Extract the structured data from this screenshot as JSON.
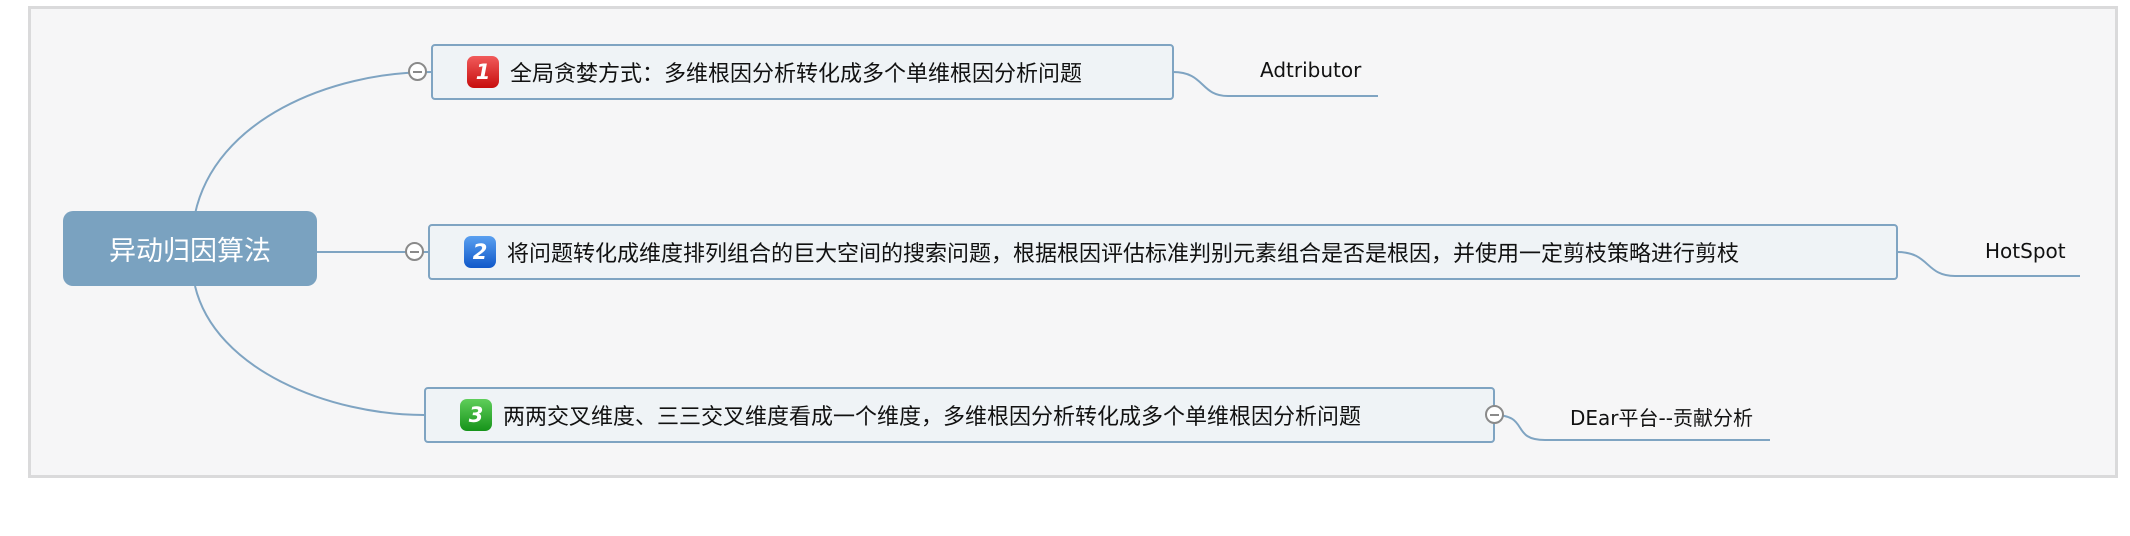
{
  "root": {
    "label": "异动归因算法"
  },
  "topics": [
    {
      "marker": "1",
      "marker_color": "#e02b2b",
      "label": "全局贪婪方式：多维根因分析转化成多个单维根因分析问题",
      "subtopic": "Adtributor"
    },
    {
      "marker": "2",
      "marker_color": "#2a74de",
      "label": "将问题转化成维度排列组合的巨大空间的搜索问题，根据根因评估标准判别元素组合是否是根因，并使用一定剪枝策略进行剪枝",
      "subtopic": "HotSpot"
    },
    {
      "marker": "3",
      "marker_color": "#2aa82a",
      "label": "两两交叉维度、三三交叉维度看成一个维度，多维根因分析转化成多个单维根因分析问题",
      "subtopic": "DEar平台--贡献分析"
    }
  ],
  "colors": {
    "root_fill": "#7aa2c0",
    "topic_fill": "#eff3f6",
    "topic_border": "#7fa4c2",
    "connector": "#6f9bbd"
  }
}
